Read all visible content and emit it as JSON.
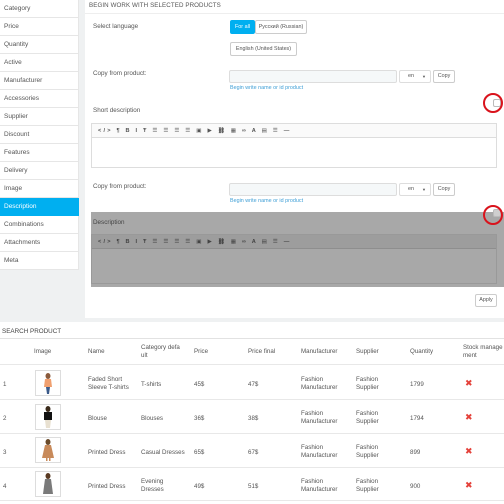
{
  "sidebar": {
    "items": [
      {
        "label": "Category"
      },
      {
        "label": "Price"
      },
      {
        "label": "Quantity"
      },
      {
        "label": "Active"
      },
      {
        "label": "Manufacturer"
      },
      {
        "label": "Accessories"
      },
      {
        "label": "Supplier"
      },
      {
        "label": "Discount"
      },
      {
        "label": "Features"
      },
      {
        "label": "Delivery"
      },
      {
        "label": "Image"
      },
      {
        "label": "Description",
        "active": true
      },
      {
        "label": "Combinations"
      },
      {
        "label": "Attachments"
      },
      {
        "label": "Meta"
      }
    ]
  },
  "panel": {
    "title": "Begin work with selected products",
    "select_language_label": "Select language",
    "lang_buttons": [
      "For all",
      "Русский (Russian)",
      "English (United States)"
    ],
    "copy_from_label": "Copy from product:",
    "hint": "Begin write name or id product",
    "lang_select": "en",
    "copy_button": "Copy",
    "short_description_label": "Short description",
    "description_label": "Description",
    "toolbar_glyphs": "</> ¶ B I Ŧ ☰ ☰ ☰ ☰ ▣ ▶ ⛓ ▦ ∞ A ▤ ☰ —",
    "apply_button": "Apply"
  },
  "search": {
    "title": "Search product",
    "headers": {
      "image": "Image",
      "name": "Name",
      "category": "Category defa ult",
      "price": "Price",
      "price_final": "Price final",
      "manufacturer": "Manufacturer",
      "supplier": "Supplier",
      "quantity": "Quantity",
      "stock": "Stock manage ment"
    },
    "rows": [
      {
        "num": "1",
        "name": "Faded Short Sleeve T-shirts",
        "category": "T-shirts",
        "price": "45$",
        "price_final": "47$",
        "manufacturer": "Fashion Manufacturer",
        "supplier": "Fashion Supplier",
        "quantity": "1799"
      },
      {
        "num": "2",
        "name": "Blouse",
        "category": "Blouses",
        "price": "36$",
        "price_final": "38$",
        "manufacturer": "Fashion Manufacturer",
        "supplier": "Fashion Supplier",
        "quantity": "1794"
      },
      {
        "num": "3",
        "name": "Printed Dress",
        "category": "Casual Dresses",
        "price": "65$",
        "price_final": "67$",
        "manufacturer": "Fashion Manufacturer",
        "supplier": "Fashion Supplier",
        "quantity": "899"
      },
      {
        "num": "4",
        "name": "Printed Dress",
        "category": "Evening Dresses",
        "price": "49$",
        "price_final": "51$",
        "manufacturer": "Fashion Manufacturer",
        "supplier": "Fashion Supplier",
        "quantity": "900"
      }
    ]
  },
  "colors": {
    "accent": "#00aff0",
    "highlight": "#d9131c",
    "danger": "#e4413a"
  }
}
